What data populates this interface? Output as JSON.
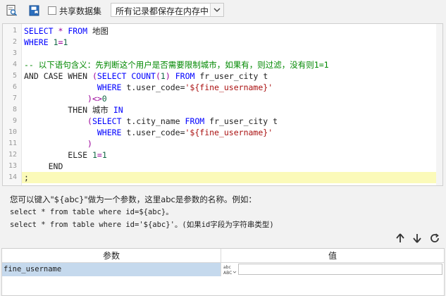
{
  "toolbar": {
    "share_dataset_label": "共享数据集",
    "storage_select_value": "所有记录都保存在内存中"
  },
  "editor": {
    "line_numbers": [
      "1",
      "2",
      "3",
      "4",
      "5",
      "6",
      "7",
      "8",
      "9",
      "10",
      "11",
      "12",
      "13",
      "14"
    ],
    "lines": [
      [
        {
          "t": "SELECT",
          "c": "kw"
        },
        {
          "t": " * ",
          "c": "op"
        },
        {
          "t": "FROM",
          "c": "kw"
        },
        {
          "t": " 地图",
          "c": "pl"
        }
      ],
      [
        {
          "t": "WHERE",
          "c": "kw"
        },
        {
          "t": " ",
          "c": "pl"
        },
        {
          "t": "1",
          "c": "num"
        },
        {
          "t": "=",
          "c": "op"
        },
        {
          "t": "1",
          "c": "num"
        }
      ],
      [],
      [
        {
          "t": "-- 以下语句含义：先判断这个用户是否需要限制城市，如果有，则过滤，没有则1=1",
          "c": "cm"
        }
      ],
      [
        {
          "t": "AND CASE WHEN ",
          "c": "pl"
        },
        {
          "t": "(",
          "c": "op"
        },
        {
          "t": "SELECT",
          "c": "kw"
        },
        {
          "t": " ",
          "c": "pl"
        },
        {
          "t": "COUNT",
          "c": "kw"
        },
        {
          "t": "(",
          "c": "op"
        },
        {
          "t": "1",
          "c": "num"
        },
        {
          "t": ")",
          "c": "op"
        },
        {
          "t": " ",
          "c": "pl"
        },
        {
          "t": "FROM",
          "c": "kw"
        },
        {
          "t": " fr_user_city t",
          "c": "pl"
        }
      ],
      [
        {
          "t": "               ",
          "c": "pl"
        },
        {
          "t": "WHERE",
          "c": "kw"
        },
        {
          "t": " t.user_code=",
          "c": "pl"
        },
        {
          "t": "'${fine_username}'",
          "c": "str"
        }
      ],
      [
        {
          "t": "             ",
          "c": "pl"
        },
        {
          "t": ")<>",
          "c": "op"
        },
        {
          "t": "0",
          "c": "num"
        }
      ],
      [
        {
          "t": "         THEN 城市 ",
          "c": "pl"
        },
        {
          "t": "IN",
          "c": "kw"
        }
      ],
      [
        {
          "t": "             ",
          "c": "pl"
        },
        {
          "t": "(",
          "c": "op"
        },
        {
          "t": "SELECT",
          "c": "kw"
        },
        {
          "t": " t.city_name ",
          "c": "pl"
        },
        {
          "t": "FROM",
          "c": "kw"
        },
        {
          "t": " fr_user_city t",
          "c": "pl"
        }
      ],
      [
        {
          "t": "               ",
          "c": "pl"
        },
        {
          "t": "WHERE",
          "c": "kw"
        },
        {
          "t": " t.user_code=",
          "c": "pl"
        },
        {
          "t": "'${fine_username}'",
          "c": "str"
        }
      ],
      [
        {
          "t": "             ",
          "c": "pl"
        },
        {
          "t": ")",
          "c": "op"
        }
      ],
      [
        {
          "t": "         ELSE ",
          "c": "pl"
        },
        {
          "t": "1",
          "c": "num"
        },
        {
          "t": "=",
          "c": "op"
        },
        {
          "t": "1",
          "c": "num"
        }
      ],
      [
        {
          "t": "     END",
          "c": "pl"
        }
      ],
      [
        {
          "t": ";",
          "c": "pl"
        }
      ]
    ],
    "active_line": 14
  },
  "help": {
    "line1": "您可以键入\"${abc}\"做为一个参数，这里abc是参数的名称。例如：",
    "line2": "select * from table where id=${abc}。",
    "line3": "select * from table where id='${abc}'。(如果id字段为字符串类型)"
  },
  "params_table": {
    "col_param": "参数",
    "col_value": "值",
    "rows": [
      {
        "param": "fine_username",
        "value": ""
      }
    ],
    "type_button_label": "ABC"
  },
  "colors": {
    "keyword": "#0000ff",
    "number": "#116644",
    "string": "#aa1111",
    "comment": "#008800",
    "active_line": "#fbfab9",
    "selected_row": "#c5d9ed"
  }
}
